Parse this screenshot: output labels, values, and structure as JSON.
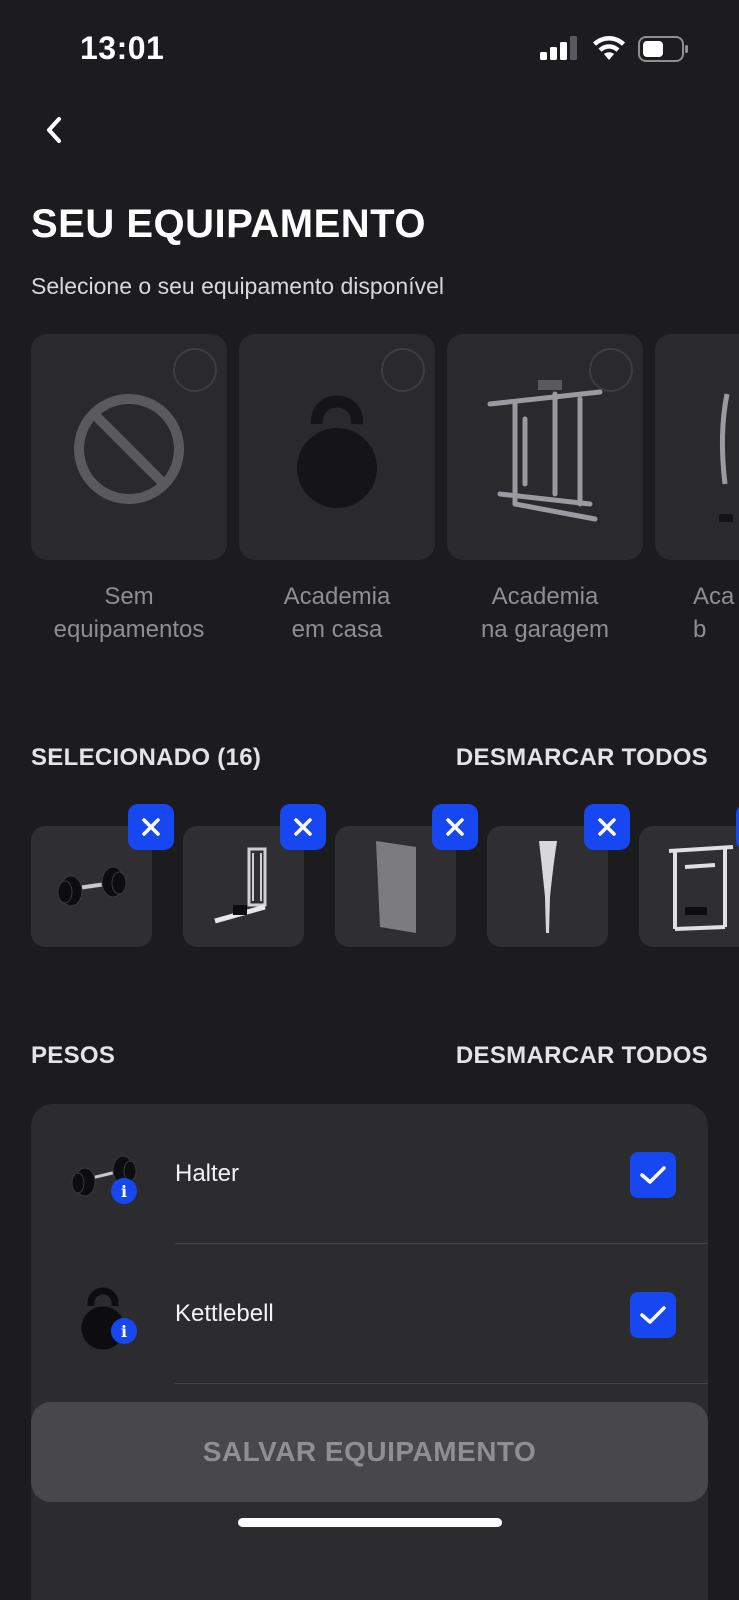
{
  "status_bar": {
    "time": "13:01",
    "signal_icon": "cellular-signal-icon",
    "wifi_icon": "wifi-icon",
    "battery_icon": "battery-icon"
  },
  "nav": {
    "back_icon": "chevron-left-icon"
  },
  "header": {
    "title": "SEU EQUIPAMENTO",
    "subtitle": "Selecione o seu equipamento disponível"
  },
  "presets": [
    {
      "label": "Sem\nequipamentos",
      "icon": "no-equipment-icon",
      "selected": false
    },
    {
      "label": "Academia\nem casa",
      "icon": "kettlebell-icon",
      "selected": false
    },
    {
      "label": "Academia\nna garagem",
      "icon": "power-rack-icon",
      "selected": false
    },
    {
      "label": "Aca\nb",
      "icon": "machine-icon",
      "selected": false
    }
  ],
  "selected_section": {
    "title": "SELECIONADO (16)",
    "action": "DESMARCAR TODOS",
    "items": [
      {
        "icon": "dumbbell-icon",
        "remove_icon": "close-icon"
      },
      {
        "icon": "cable-machine-icon",
        "remove_icon": "close-icon"
      },
      {
        "icon": "plyo-box-icon",
        "remove_icon": "close-icon"
      },
      {
        "icon": "indian-club-icon",
        "remove_icon": "close-icon"
      },
      {
        "icon": "smith-machine-icon",
        "remove_icon": "close-icon"
      }
    ]
  },
  "weights_section": {
    "title": "PESOS",
    "action": "DESMARCAR TODOS",
    "items": [
      {
        "label": "Halter",
        "icon": "dumbbell-icon",
        "info": "i",
        "checked": true
      },
      {
        "label": "Kettlebell",
        "icon": "kettlebell-icon",
        "info": "i",
        "checked": true
      }
    ]
  },
  "save_button": {
    "label": "SALVAR EQUIPAMENTO"
  },
  "colors": {
    "background": "#1c1c1e",
    "card": "#2a2a2d",
    "accent": "#1747f0",
    "muted_text": "#8e8e93"
  }
}
